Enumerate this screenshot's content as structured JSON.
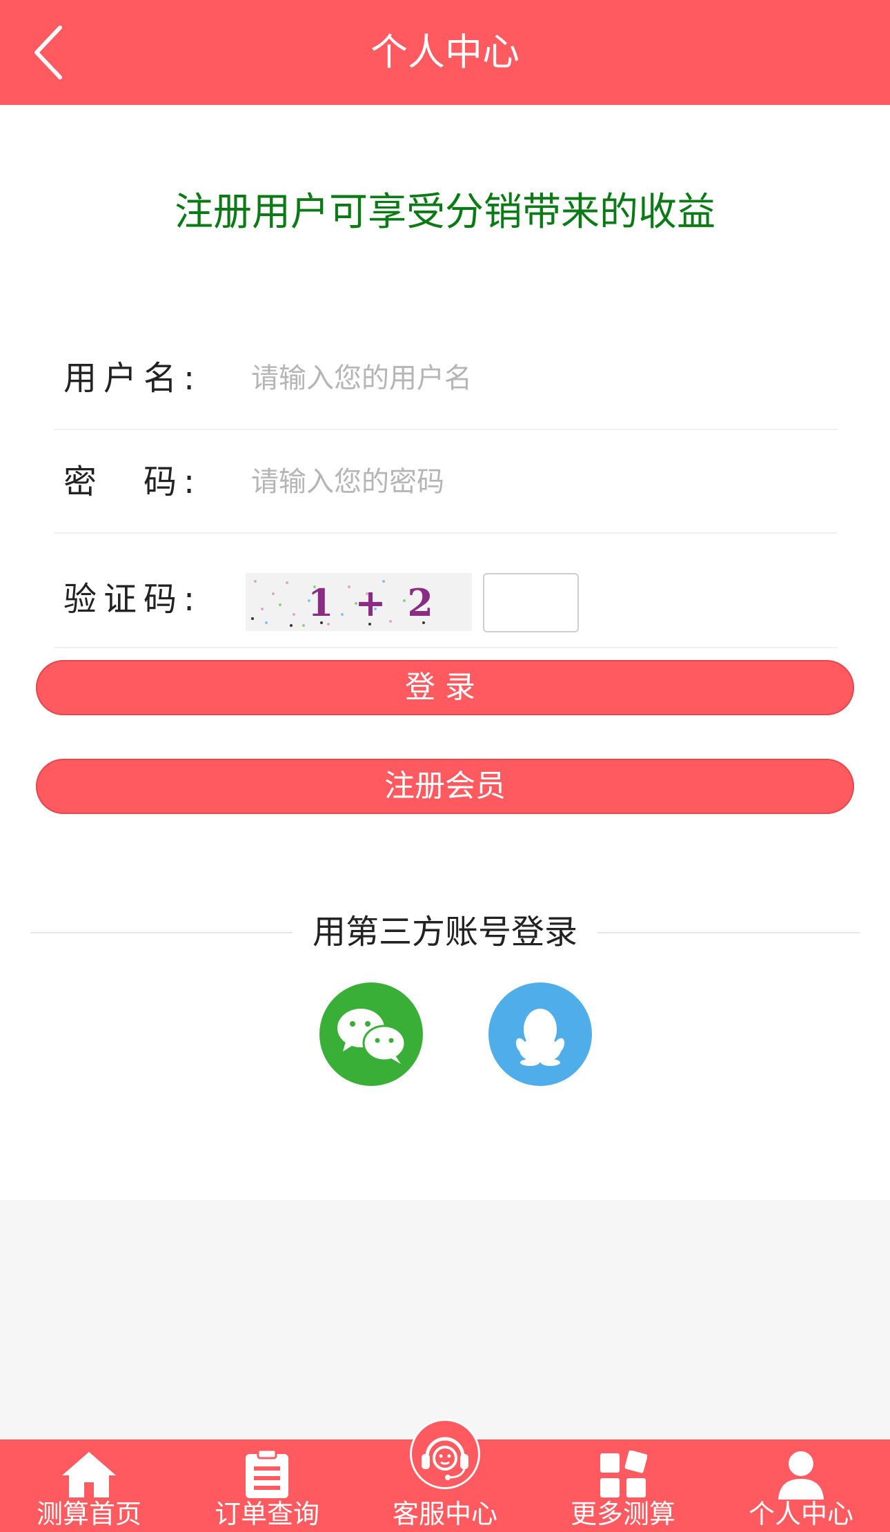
{
  "header": {
    "title": "个人中心",
    "back_icon": "chevron-left-icon"
  },
  "promo_text": "注册用户可享受分销带来的收益",
  "form": {
    "username": {
      "label": "用户名:",
      "placeholder": "请输入您的用户名"
    },
    "password": {
      "label": "密　码:",
      "placeholder": "请输入您的密码"
    },
    "captcha": {
      "label": "验证码:",
      "expression": "1 + 2 ="
    }
  },
  "buttons": {
    "login": "登录",
    "register": "注册会员"
  },
  "third_party": {
    "title": "用第三方账号登录",
    "wechat_icon": "wechat-icon",
    "qq_icon": "qq-icon"
  },
  "tabbar": [
    {
      "label": "测算首页",
      "icon": "home-icon"
    },
    {
      "label": "订单查询",
      "icon": "clipboard-icon"
    },
    {
      "label": "客服中心",
      "icon": "headset-icon"
    },
    {
      "label": "更多测算",
      "icon": "grid-icon"
    },
    {
      "label": "个人中心",
      "icon": "user-icon"
    }
  ],
  "colors": {
    "brand": "#ff5a5f",
    "promo": "#0a7a14",
    "wechat": "#3aaf37",
    "qq": "#4faee9"
  }
}
